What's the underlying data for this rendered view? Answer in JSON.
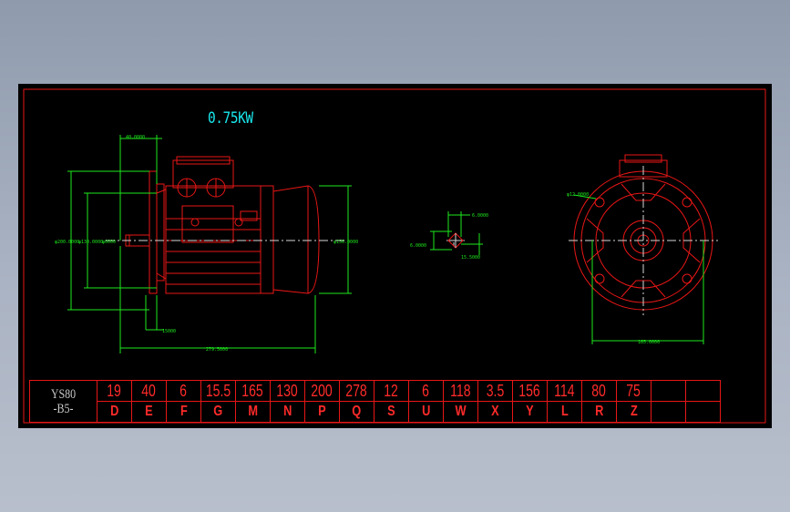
{
  "drawing": {
    "power": "0.75KW",
    "model_line1": "YS80",
    "model_line2": "-B5-",
    "dimension_values": [
      "19",
      "40",
      "6",
      "15.5",
      "165",
      "130",
      "200",
      "278",
      "12",
      "6",
      "118",
      "3.5",
      "156",
      "114",
      "80",
      "75",
      "",
      ""
    ],
    "dimension_codes": [
      "D",
      "E",
      "F",
      "G",
      "M",
      "N",
      "P",
      "Q",
      "S",
      "U",
      "W",
      "X",
      "Y",
      "L",
      "R",
      "Z",
      "",
      ""
    ],
    "annotations": {
      "top_e": "40.0000",
      "flange_dia": "φ200.0000",
      "spigot_dia": "φ130.0000",
      "shaft_dia": "φ0000",
      "fan_cover_dia": "φ156.0000",
      "flange_thk": "15000",
      "overall_length": "279.5000",
      "key_w": "6.0000",
      "key_h": "15.5000",
      "key_left": "6.0000",
      "bolt_hole": "φ12.0000",
      "bolt_circle": "165.0000"
    },
    "colors": {
      "frame": "#e81616",
      "motor": "#e81616",
      "dimension": "#1ee81e",
      "centerline": "#d8d8d8",
      "title": "#19e8ee"
    }
  }
}
